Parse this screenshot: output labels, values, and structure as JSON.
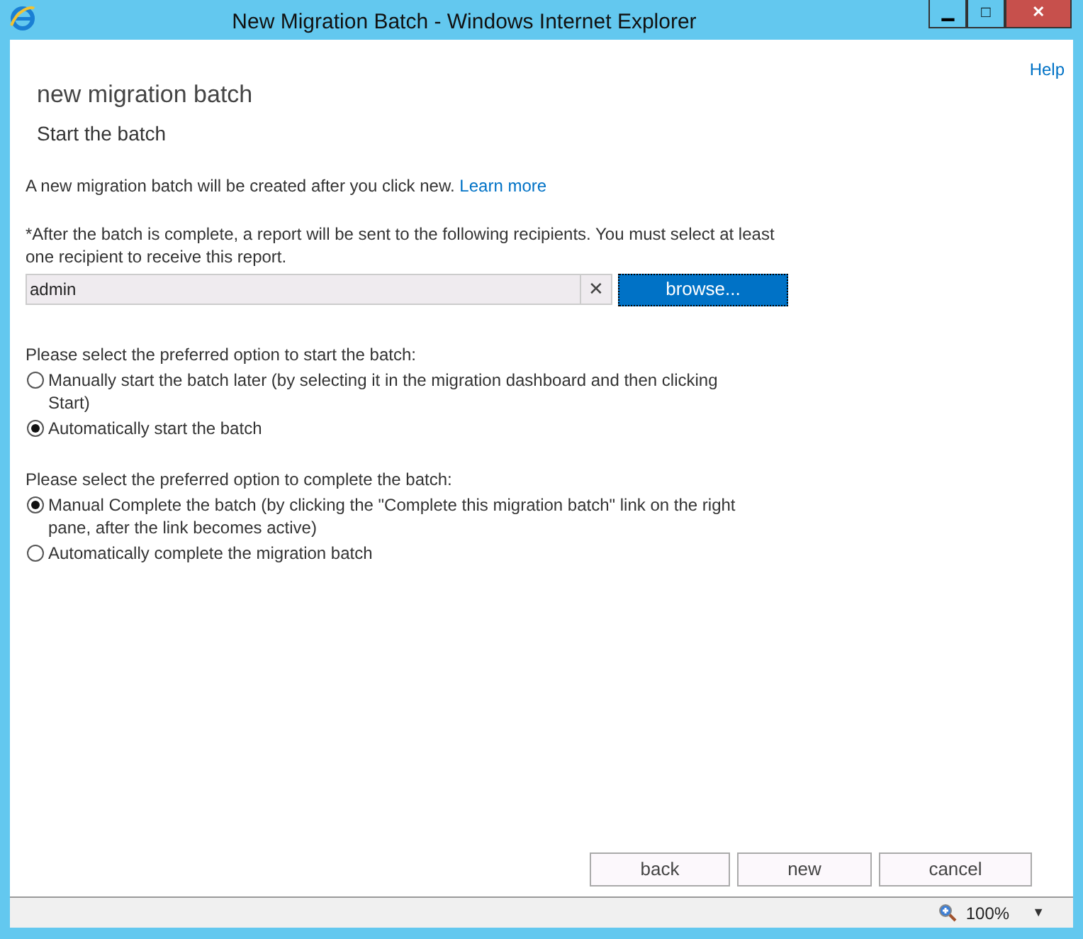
{
  "window": {
    "title": "New Migration Batch - Windows Internet Explorer",
    "controls": [
      "▁",
      "□",
      "✕"
    ]
  },
  "help_link": "Help",
  "heading": "new migration batch",
  "subheading": "Start the batch",
  "intro": {
    "text": "A new migration batch will be created after you click new.",
    "link": "Learn more"
  },
  "recipients": {
    "note": "*After the batch is complete, a report will be sent to the following recipients. You must select at least one recipient to receive this report.",
    "value": "admin",
    "clear": "✕",
    "browse": "browse..."
  },
  "start_group": {
    "label": "Please select the preferred option to start the batch:",
    "options": [
      {
        "label": "Manually start the batch later (by selecting it in the migration dashboard and then clicking Start)",
        "selected": false
      },
      {
        "label": "Automatically start the batch",
        "selected": true
      }
    ]
  },
  "complete_group": {
    "label": "Please select the preferred option to complete the batch:",
    "options": [
      {
        "label": "Manual Complete the batch (by clicking the \"Complete this migration batch\" link on the right pane, after the link becomes active)",
        "selected": true
      },
      {
        "label": "Automatically complete the migration batch",
        "selected": false
      }
    ]
  },
  "buttons": [
    "back",
    "new",
    "cancel"
  ],
  "status_bar": {
    "zoom": "100%",
    "dropdown": "▼"
  }
}
